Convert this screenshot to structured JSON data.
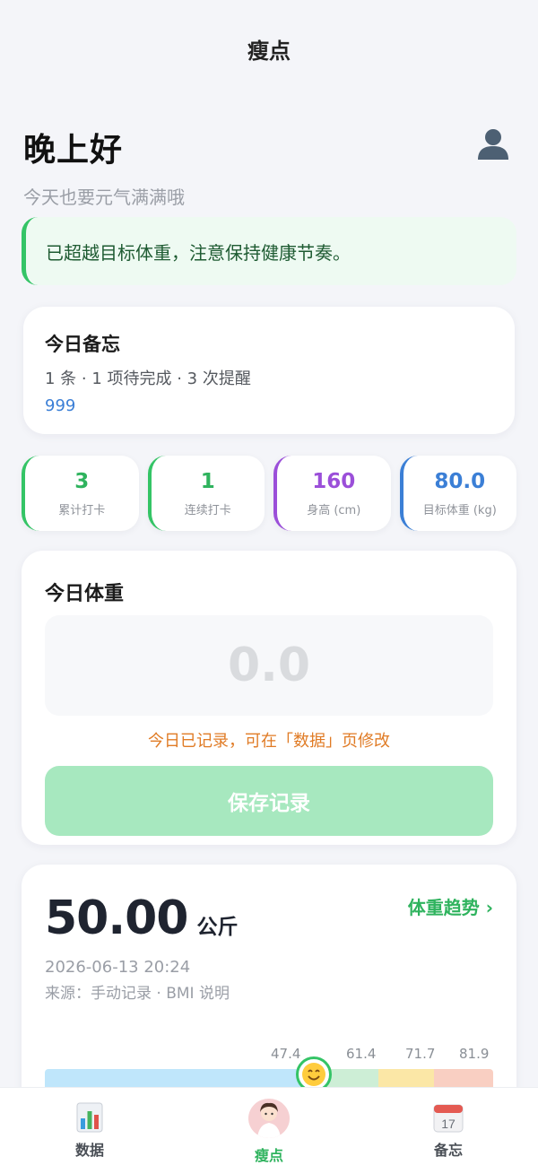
{
  "header": {
    "title": "瘦点"
  },
  "greeting": {
    "title": "晚上好",
    "subtitle": "今天也要元气满满哦"
  },
  "alert": {
    "text": "已超越目标体重，注意保持健康节奏。"
  },
  "memo": {
    "title": "今日备忘",
    "summary": "1 条 · 1 项待完成 · 3 次提醒",
    "link": "999"
  },
  "stats": [
    {
      "value": "3",
      "label": "累计打卡",
      "color": "#2fb35e"
    },
    {
      "value": "1",
      "label": "连续打卡",
      "color": "#2fb35e"
    },
    {
      "value": "160",
      "label": "身高 (cm)",
      "color": "#9b4fd9"
    },
    {
      "value": "80.0",
      "label": "目标体重 (kg)",
      "color": "#3b7fd6"
    }
  ],
  "weight_entry": {
    "title": "今日体重",
    "placeholder": "0.0",
    "hint": "今日已记录，可在「数据」页修改",
    "save_label": "保存记录"
  },
  "latest": {
    "value": "50.00",
    "unit": "公斤",
    "trend_label": "体重趋势 ›",
    "timestamp": "2026-06-13 20:24",
    "source": "来源：手动记录 · BMI 说明"
  },
  "bmi_scale": {
    "ticks": [
      "47.4",
      "61.4",
      "71.7",
      "81.9"
    ],
    "segment_colors": [
      "#bfe6fb",
      "#cdeed6",
      "#fbe7a6",
      "#f9cfc2"
    ],
    "marker_icon": "smile-face-icon"
  },
  "tabs": [
    {
      "label": "数据",
      "icon": "bar-chart-icon"
    },
    {
      "label": "瘦点",
      "icon": "mascot-icon"
    },
    {
      "label": "备忘",
      "icon": "calendar-icon",
      "icon_text": "17"
    }
  ],
  "colors": {
    "accent": "#34c466",
    "warning": "#e07b25",
    "link": "#3b7fd6"
  }
}
